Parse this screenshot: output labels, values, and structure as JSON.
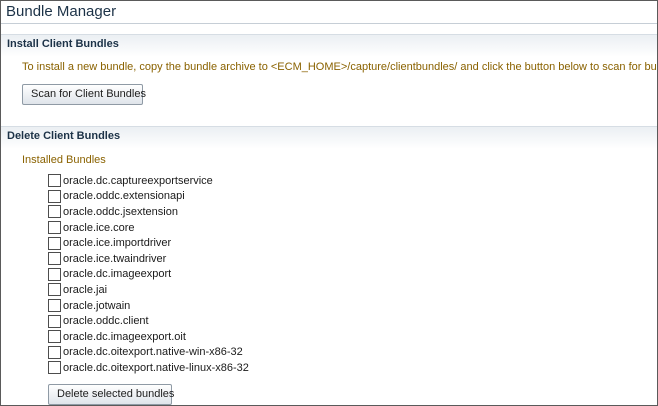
{
  "page": {
    "title": "Bundle Manager"
  },
  "install_section": {
    "title": "Install Client Bundles",
    "instructions": "To install a new bundle, copy the bundle archive to <ECM_HOME>/capture/clientbundles/ and click the button below to scan for bundle changes.",
    "scan_button_label": "Scan for Client Bundles"
  },
  "delete_section": {
    "title": "Delete Client Bundles",
    "installed_label": "Installed Bundles",
    "bundles": [
      {
        "name": "oracle.dc.captureexportservice",
        "checked": false
      },
      {
        "name": "oracle.oddc.extensionapi",
        "checked": false
      },
      {
        "name": "oracle.oddc.jsextension",
        "checked": false
      },
      {
        "name": "oracle.ice.core",
        "checked": false
      },
      {
        "name": "oracle.ice.importdriver",
        "checked": false
      },
      {
        "name": "oracle.ice.twaindriver",
        "checked": false
      },
      {
        "name": "oracle.dc.imageexport",
        "checked": false
      },
      {
        "name": "oracle.jai",
        "checked": false
      },
      {
        "name": "oracle.jotwain",
        "checked": false
      },
      {
        "name": "oracle.oddc.client",
        "checked": false
      },
      {
        "name": "oracle.dc.imageexport.oit",
        "checked": false
      },
      {
        "name": "oracle.dc.oitexport.native-win-x86-32",
        "checked": false
      },
      {
        "name": "oracle.dc.oitexport.native-linux-x86-32",
        "checked": false
      }
    ],
    "delete_button_label": "Delete selected bundles"
  },
  "colors": {
    "heading": "#1c3247",
    "instruction_text": "#8a6200",
    "section_band": "#ebeff3"
  }
}
